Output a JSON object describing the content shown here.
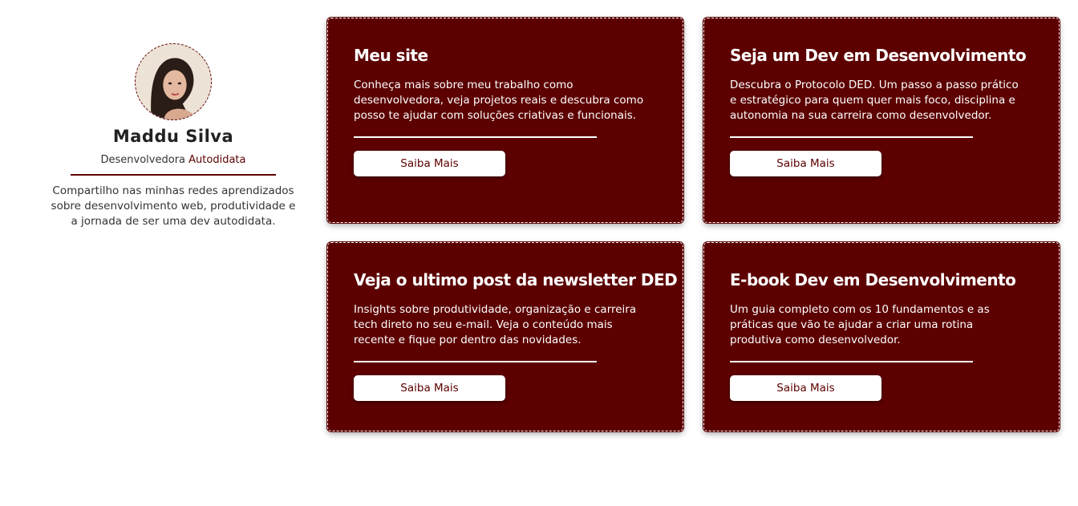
{
  "profile": {
    "name": "Maddu Silva",
    "role_prefix": "Desenvolvedora ",
    "role_accent": "Autodidata",
    "bio": "Compartilho nas minhas redes aprendizados sobre desenvolvimento web, produtividade e a jornada de ser uma dev autodidata."
  },
  "cards": [
    {
      "title": "Meu site",
      "text": "Conheça mais sobre meu trabalho como desenvolvedora, veja projetos reais e descubra como posso te ajudar com soluções criativas e funcionais.",
      "button": "Saiba Mais"
    },
    {
      "title": "Seja um Dev em Desenvolvimento",
      "text": "Descubra o Protocolo DED. Um passo a passo prático e estratégico para quem quer mais foco, disciplina e autonomia na sua carreira como desenvolvedor.",
      "button": "Saiba Mais"
    },
    {
      "title": "Veja o ultimo post da newsletter DED",
      "text": "Insights sobre produtividade, organização e carreira tech direto no seu e-mail. Veja o conteúdo mais recente e fique por dentro das novidades.",
      "button": "Saiba Mais"
    },
    {
      "title": "E-book Dev em Desenvolvimento",
      "text": "Um guia completo com os 10 fundamentos e as práticas que vão te ajudar a criar uma rotina produtiva como desenvolvedor.",
      "button": "Saiba Mais"
    }
  ],
  "colors": {
    "accent": "#5c0000",
    "text": "#222222",
    "background": "#ffffff"
  }
}
